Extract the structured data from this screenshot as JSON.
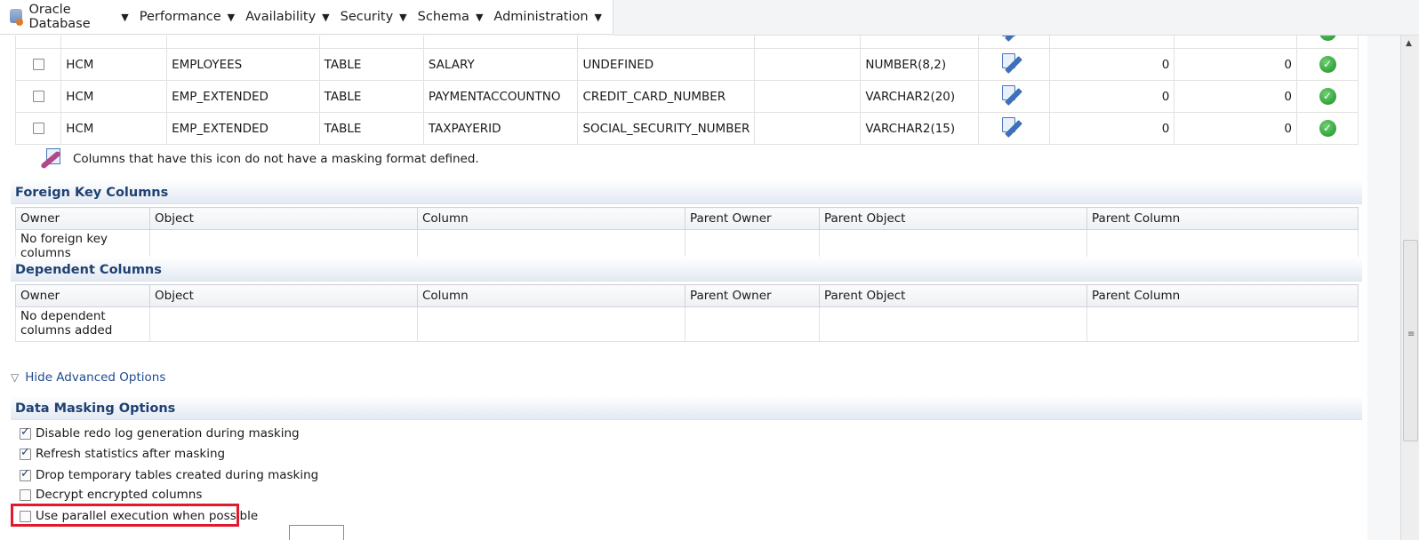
{
  "menu": {
    "items": [
      {
        "label": "Oracle Database"
      },
      {
        "label": "Performance"
      },
      {
        "label": "Availability"
      },
      {
        "label": "Security"
      },
      {
        "label": "Schema"
      },
      {
        "label": "Administration"
      }
    ]
  },
  "columns_table": {
    "rows": [
      {
        "checked": false,
        "owner": "HCM",
        "table": "EMPLOYEES",
        "type": "TABLE",
        "column": "SALARY",
        "sensitive_type": "UNDEFINED",
        "extra": "",
        "data_type": "NUMBER(8,2)",
        "val1": "0",
        "val2": "0"
      },
      {
        "checked": false,
        "owner": "HCM",
        "table": "EMP_EXTENDED",
        "type": "TABLE",
        "column": "PAYMENTACCOUNTNO",
        "sensitive_type": "CREDIT_CARD_NUMBER",
        "extra": "",
        "data_type": "VARCHAR2(20)",
        "val1": "0",
        "val2": "0"
      },
      {
        "checked": false,
        "owner": "HCM",
        "table": "EMP_EXTENDED",
        "type": "TABLE",
        "column": "TAXPAYERID",
        "sensitive_type": "SOCIAL_SECURITY_NUMBER",
        "extra": "",
        "data_type": "VARCHAR2(15)",
        "val1": "0",
        "val2": "0"
      }
    ]
  },
  "note": {
    "text": "Columns that have this icon do not have a masking format defined."
  },
  "foreign_key": {
    "title": "Foreign Key Columns",
    "headers": [
      "Owner",
      "Object",
      "Column",
      "Parent Owner",
      "Parent Object",
      "Parent Column"
    ],
    "empty": "No foreign key columns"
  },
  "dependent": {
    "title": "Dependent Columns",
    "headers": [
      "Owner",
      "Object",
      "Column",
      "Parent Owner",
      "Parent Object",
      "Parent Column"
    ],
    "empty": "No dependent columns added"
  },
  "advanced": {
    "toggle_label": "Hide Advanced Options"
  },
  "masking_options": {
    "title": "Data Masking Options",
    "options": [
      {
        "label": "Disable redo log generation during masking",
        "checked": true
      },
      {
        "label": "Refresh statistics after masking",
        "checked": true
      },
      {
        "label": "Drop temporary tables created during masking",
        "checked": true
      },
      {
        "label": "Decrypt encrypted columns",
        "checked": false
      },
      {
        "label": "Use parallel execution when possible",
        "checked": false
      }
    ]
  }
}
